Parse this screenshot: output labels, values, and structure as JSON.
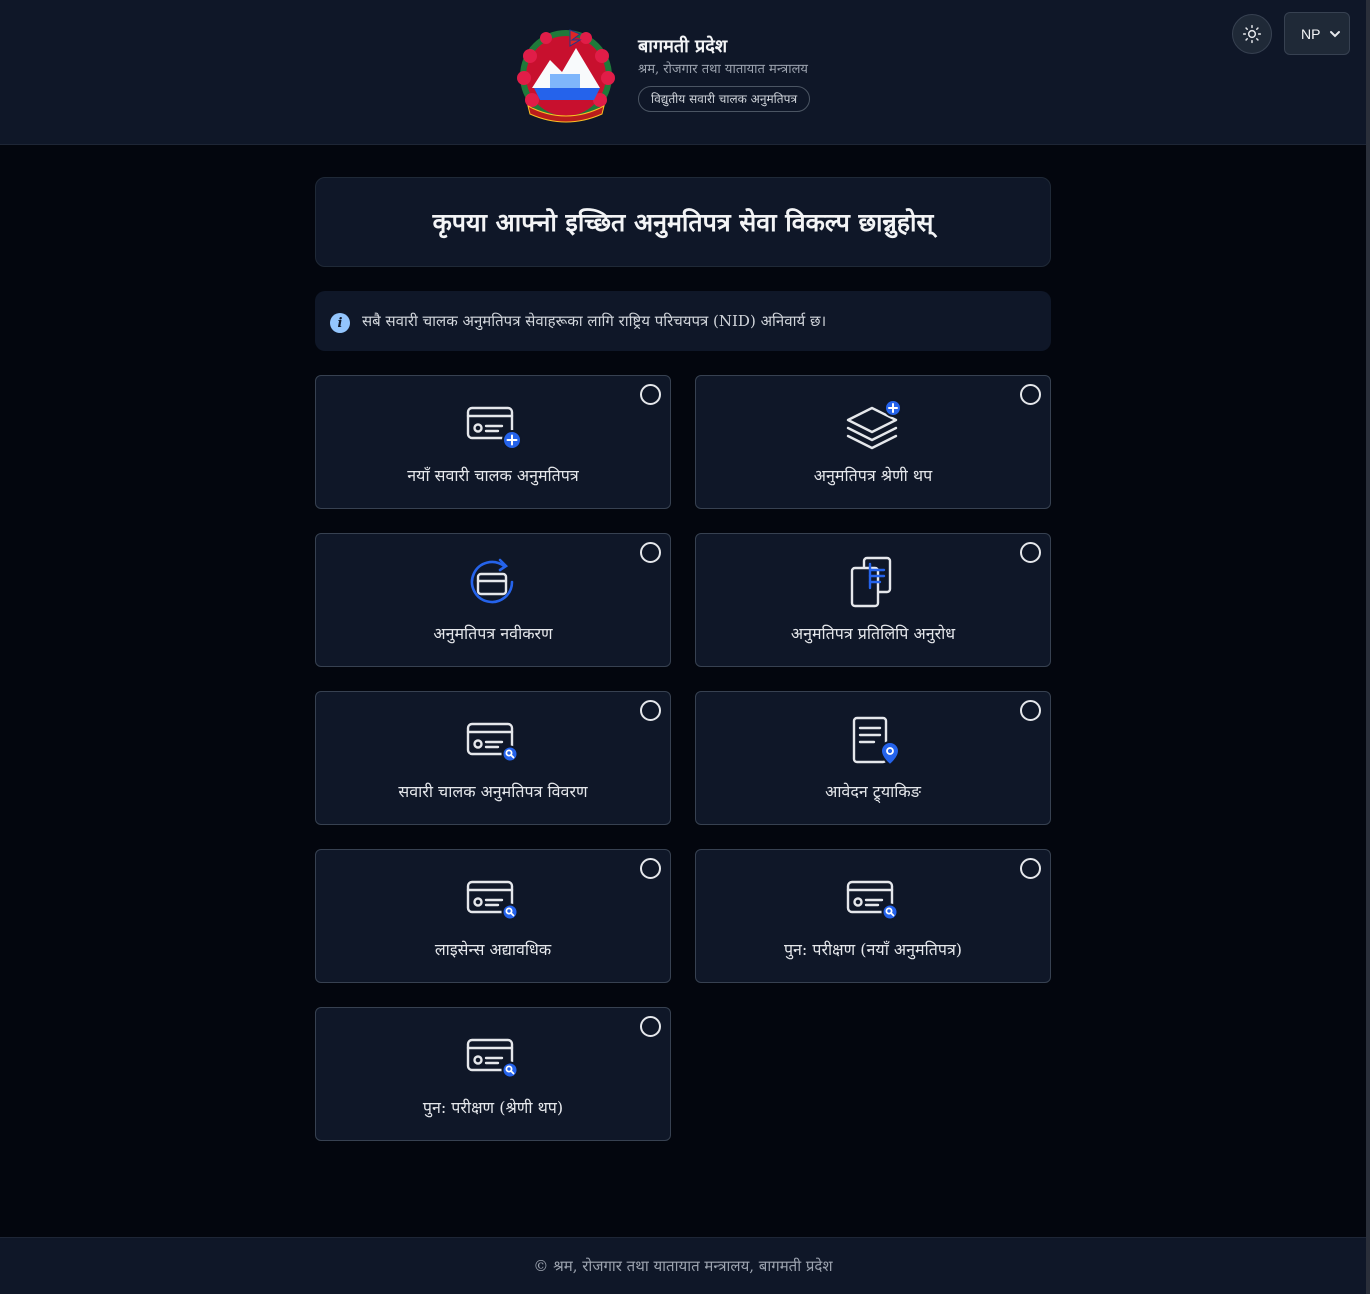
{
  "header": {
    "title": "बागमती प्रदेश",
    "subtitle": "श्रम, रोजगार तथा यातायात मन्त्रालय",
    "pill": "विद्युतीय सवारी चालक अनुमतिपत्र",
    "language": "NP"
  },
  "main": {
    "title": "कृपया आफ्नो इच्छित अनुमतिपत्र सेवा विकल्प छान्नुहोस्",
    "info_icon_text": "i",
    "info": "सबै सवारी चालक अनुमतिपत्र सेवाहरूका लागि राष्ट्रिय परिचयपत्र (NID) अनिवार्य छ।",
    "options": [
      {
        "label": "नयाँ सवारी चालक अनुमतिपत्र",
        "icon": "card-plus-icon"
      },
      {
        "label": "अनुमतिपत्र श्रेणी थप",
        "icon": "layers-plus-icon"
      },
      {
        "label": "अनुमतिपत्र नवीकरण",
        "icon": "renew-card-icon"
      },
      {
        "label": "अनुमतिपत्र प्रतिलिपि अनुरोध",
        "icon": "duplicate-document-icon"
      },
      {
        "label": "सवारी चालक अनुमतिपत्र विवरण",
        "icon": "card-search-icon"
      },
      {
        "label": "आवेदन ट्र्याकिङ",
        "icon": "document-location-icon"
      },
      {
        "label": "लाइसेन्स अद्यावधिक",
        "icon": "card-search-icon"
      },
      {
        "label": "पुन: परीक्षण (नयाँ अनुमतिपत्र)",
        "icon": "card-search-icon"
      },
      {
        "label": "पुन: परीक्षण (श्रेणी थप)",
        "icon": "card-search-icon"
      }
    ]
  },
  "footer": {
    "text": "© श्रम, रोजगार तथा यातायात मन्त्रालय, बागमती प्रदेश"
  },
  "colors": {
    "page_bg": "#03060e",
    "panel_bg": "#0f1728",
    "accent": "#2563eb",
    "icon_stroke": "#e5e7eb"
  }
}
